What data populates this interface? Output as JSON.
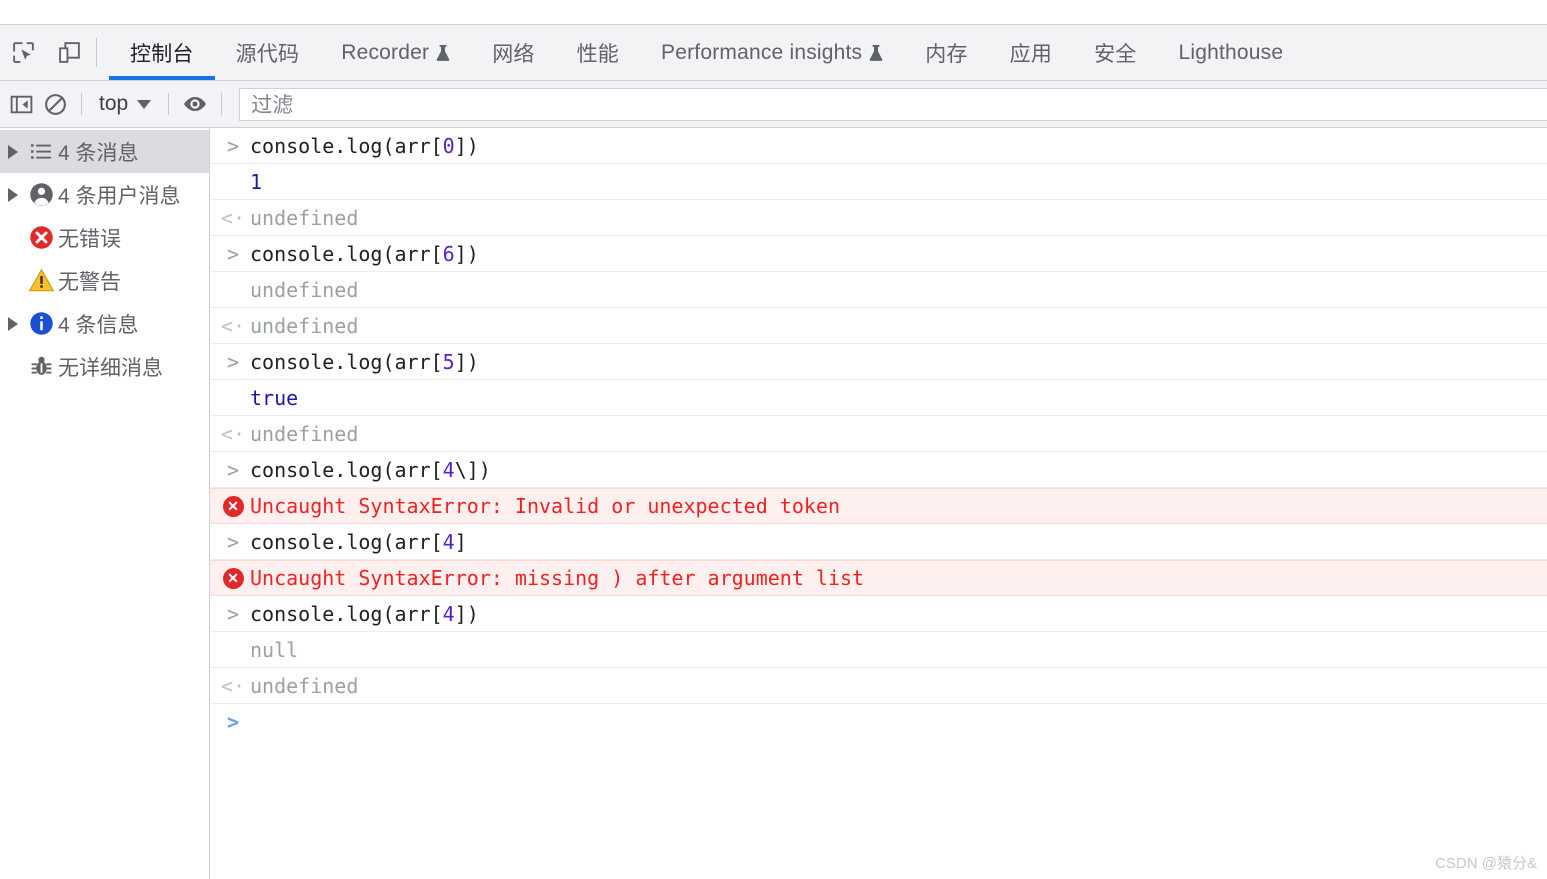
{
  "colors": {
    "accent": "#1a73e8",
    "error": "#ef2222",
    "error_bg": "#fff0f0",
    "toolbar_bg": "#f1f3f4",
    "selected_bg": "#dadce0",
    "number": "#5622cc",
    "value": "#1a1aa6",
    "muted": "#9aa0a6"
  },
  "toolbar": {
    "inspect_icon": "inspect-element-icon",
    "device_icon": "device-toolbar-icon",
    "tabs": [
      {
        "label": "控制台",
        "active": true,
        "badge": ""
      },
      {
        "label": "源代码",
        "active": false,
        "badge": ""
      },
      {
        "label": "Recorder",
        "active": false,
        "badge": "flask-icon"
      },
      {
        "label": "网络",
        "active": false,
        "badge": ""
      },
      {
        "label": "性能",
        "active": false,
        "badge": ""
      },
      {
        "label": "Performance insights",
        "active": false,
        "badge": "flask-icon"
      },
      {
        "label": "内存",
        "active": false,
        "badge": ""
      },
      {
        "label": "应用",
        "active": false,
        "badge": ""
      },
      {
        "label": "安全",
        "active": false,
        "badge": ""
      },
      {
        "label": "Lighthouse",
        "active": false,
        "badge": ""
      }
    ]
  },
  "filterbar": {
    "sidebar_toggle_icon": "show-console-sidebar-icon",
    "clear_icon": "clear-console-icon",
    "context_value": "top",
    "eye_icon": "live-expression-eye-icon",
    "filter_placeholder": "过滤"
  },
  "sidebar": {
    "items": [
      {
        "label": "4 条消息",
        "icon": "list-icon",
        "expandable": true,
        "selected": true
      },
      {
        "label": "4 条用户消息",
        "icon": "user-icon",
        "expandable": true,
        "selected": false
      },
      {
        "label": "无错误",
        "icon": "error-icon",
        "expandable": false,
        "selected": false
      },
      {
        "label": "无警告",
        "icon": "warning-icon",
        "expandable": false,
        "selected": false
      },
      {
        "label": "4 条信息",
        "icon": "info-icon",
        "expandable": true,
        "selected": false
      },
      {
        "label": "无详细消息",
        "icon": "bug-icon",
        "expandable": false,
        "selected": false
      }
    ]
  },
  "console": {
    "rows": [
      {
        "kind": "input",
        "gutter": ">",
        "code": "console.log(arr[",
        "num": "0",
        "tail": "])"
      },
      {
        "kind": "output",
        "gutter": "",
        "value": "1",
        "style": "value"
      },
      {
        "kind": "returned",
        "gutter": "<·",
        "value": "undefined",
        "style": "muted"
      },
      {
        "kind": "input",
        "gutter": ">",
        "code": "console.log(arr[",
        "num": "6",
        "tail": "])"
      },
      {
        "kind": "output",
        "gutter": "",
        "value": "undefined",
        "style": "muted"
      },
      {
        "kind": "returned",
        "gutter": "<·",
        "value": "undefined",
        "style": "muted"
      },
      {
        "kind": "input",
        "gutter": ">",
        "code": "console.log(arr[",
        "num": "5",
        "tail": "])"
      },
      {
        "kind": "output",
        "gutter": "",
        "value": "true",
        "style": "value"
      },
      {
        "kind": "returned",
        "gutter": "<·",
        "value": "undefined",
        "style": "muted"
      },
      {
        "kind": "input",
        "gutter": ">",
        "code": "console.log(arr[",
        "num": "4",
        "tail": "\\])"
      },
      {
        "kind": "error",
        "gutter": "x",
        "value": "Uncaught SyntaxError: Invalid or unexpected token"
      },
      {
        "kind": "input",
        "gutter": ">",
        "code": "console.log(arr[",
        "num": "4",
        "tail": "]"
      },
      {
        "kind": "error",
        "gutter": "x",
        "value": "Uncaught SyntaxError: missing ) after argument list"
      },
      {
        "kind": "input",
        "gutter": ">",
        "code": "console.log(arr[",
        "num": "4",
        "tail": "])"
      },
      {
        "kind": "output",
        "gutter": "",
        "value": "null",
        "style": "muted"
      },
      {
        "kind": "returned",
        "gutter": "<·",
        "value": "undefined",
        "style": "muted"
      },
      {
        "kind": "prompt",
        "gutter": ">",
        "value": ""
      }
    ]
  },
  "watermark": "CSDN @猿分&"
}
